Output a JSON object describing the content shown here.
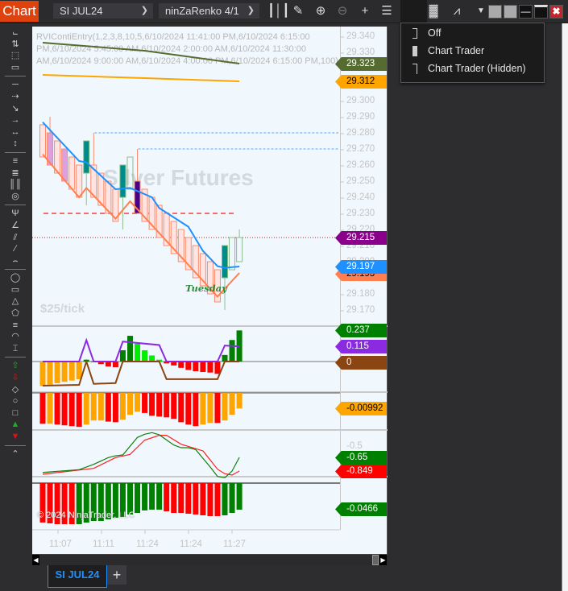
{
  "toolbar": {
    "chart_label": "Chart",
    "instrument": "SI JUL24",
    "interval": "ninZaRenko 4/1",
    "icons": [
      "bar-type-icon",
      "pencil-icon",
      "zoom-in-icon",
      "zoom-out-icon",
      "crosshair-icon",
      "properties-icon",
      "chart-trader-icon",
      "data-box-icon",
      "indicators-icon",
      "dropdown-arrow-icon"
    ]
  },
  "chart_trader_menu": {
    "items": [
      {
        "label": "Off"
      },
      {
        "label": "Chart Trader"
      },
      {
        "label": "Chart Trader (Hidden)"
      }
    ]
  },
  "left_tools": [
    "ruler",
    "risk-reward",
    "region-v",
    "region-h",
    "|",
    "line",
    "ray",
    "arrow-line",
    "extended-line",
    "horizontal-line",
    "vertical-line",
    "|",
    "andrews-pitchfork",
    "fib-retracement",
    "fib-time",
    "fib-circle",
    "|",
    "gann-fan",
    "regression",
    "trend-channel",
    "parallel",
    "arc",
    "|",
    "ellipse",
    "rectangle",
    "triangle",
    "polygon",
    "time-cycles",
    "arc2",
    "text",
    "|",
    "arrow-up",
    "arrow-down",
    "diamond",
    "dot",
    "square",
    "triangle-up",
    "triangle-down",
    "|",
    "more"
  ],
  "indicator_text": "RVIContiEntry(1,2,3,8,10,5,6/10/2024 11:41:00 PM,6/10/2024 6:15:00 PM,6/10/2024 5:45:00 AM,6/10/2024 2:00:00 AM,6/10/2024 11:30:00 AM,6/10/2024 9:00:00 AM,6/10/2024 4:00:00 PM,6/10/2024 6:15:00 PM,100)",
  "watermark": "Silver Futures",
  "tick_value": "$25/tick",
  "day_label": "Tuesday",
  "copyright": "© 2024 NinjaTrader, LLC",
  "price_axis": [
    "29.340",
    "29.330",
    "29.320",
    "29.310",
    "29.300",
    "29.290",
    "29.280",
    "29.270",
    "29.260",
    "29.250",
    "29.240",
    "29.230",
    "29.220",
    "29.210",
    "29.200",
    "29.190",
    "29.180",
    "29.170"
  ],
  "price_tags": [
    {
      "value": "29.323",
      "bg": "#556b2f",
      "fg": "#ffffff",
      "price": 29.323
    },
    {
      "value": "29.312",
      "bg": "#ffa500",
      "fg": "#000000",
      "price": 29.312
    },
    {
      "value": "29.215",
      "bg": "#8b008b",
      "fg": "#ffffff",
      "price": 29.215
    },
    {
      "value": "29.193",
      "bg": "#ff7f50",
      "fg": "#000000",
      "price": 29.193
    },
    {
      "value": "29.197",
      "bg": "#1e90ff",
      "fg": "#ffffff",
      "price": 29.197
    }
  ],
  "pane_tags": [
    {
      "value": "0.237",
      "bg": "#008000",
      "fg": "#ffffff"
    },
    {
      "value": "0.115",
      "bg": "#8a2be2",
      "fg": "#ffffff"
    },
    {
      "value": "0",
      "bg": "#8b4513",
      "fg": "#ffffff"
    },
    {
      "value": "-0.00992",
      "bg": "#ffa500",
      "fg": "#000000"
    },
    {
      "value": "-0.65",
      "bg": "#008000",
      "fg": "#ffffff"
    },
    {
      "value": "-0.849",
      "bg": "#ff0000",
      "fg": "#ffffff"
    },
    {
      "value": "-0.0466",
      "bg": "#008000",
      "fg": "#ffffff"
    }
  ],
  "pane4_axis": "-0.5",
  "time_axis": [
    "11:07",
    "11:11",
    "11:24",
    "11:24",
    "11:27"
  ],
  "tabs": [
    {
      "label": "SI JUL24"
    }
  ],
  "add_tab": "+",
  "chart_data": {
    "type": "renko",
    "bars": [
      {
        "o": 29.285,
        "c": 29.265,
        "s": "bear"
      },
      {
        "o": 29.28,
        "c": 29.26,
        "h": 29.29,
        "s": "lav"
      },
      {
        "o": 29.275,
        "c": 29.255,
        "s": "bear"
      },
      {
        "o": 29.27,
        "c": 29.25,
        "s": "lav"
      },
      {
        "o": 29.265,
        "c": 29.245,
        "s": "bear"
      },
      {
        "o": 29.26,
        "c": 29.24,
        "s": "bear"
      },
      {
        "o": 29.255,
        "c": 29.275,
        "l": 29.235,
        "s": "teal"
      },
      {
        "o": 29.26,
        "c": 29.24,
        "h": 29.28,
        "s": "bear"
      },
      {
        "o": 29.255,
        "c": 29.235,
        "s": "bear"
      },
      {
        "o": 29.25,
        "c": 29.23,
        "s": "bear"
      },
      {
        "o": 29.245,
        "c": 29.225,
        "s": "bear"
      },
      {
        "o": 29.24,
        "c": 29.26,
        "l": 29.22,
        "s": "teal"
      },
      {
        "o": 29.245,
        "c": 29.265,
        "s": "hollow"
      },
      {
        "o": 29.25,
        "c": 29.23,
        "h": 29.27,
        "s": "indigo"
      },
      {
        "o": 29.245,
        "c": 29.225,
        "s": "bear"
      },
      {
        "o": 29.24,
        "c": 29.22,
        "s": "bear"
      },
      {
        "o": 29.235,
        "c": 29.215,
        "s": "bear"
      },
      {
        "o": 29.23,
        "c": 29.21,
        "s": "bear"
      },
      {
        "o": 29.225,
        "c": 29.205,
        "s": "bear"
      },
      {
        "o": 29.22,
        "c": 29.2,
        "s": "bear"
      },
      {
        "o": 29.215,
        "c": 29.195,
        "s": "bear"
      },
      {
        "o": 29.21,
        "c": 29.19,
        "s": "bear"
      },
      {
        "o": 29.205,
        "c": 29.185,
        "s": "bear"
      },
      {
        "o": 29.2,
        "c": 29.18,
        "s": "bear"
      },
      {
        "o": 29.195,
        "c": 29.175,
        "s": "bear"
      },
      {
        "o": 29.19,
        "c": 29.21,
        "l": 29.17,
        "s": "teal"
      },
      {
        "o": 29.195,
        "c": 29.215,
        "s": "hollow"
      },
      {
        "o": 29.2,
        "c": 29.215,
        "h": 29.22,
        "s": "hollow"
      }
    ],
    "blue_line": [
      [
        0,
        29.2866
      ],
      [
        5,
        29.2625
      ],
      [
        6,
        29.2617
      ],
      [
        10,
        29.245
      ],
      [
        12,
        29.2458
      ],
      [
        15,
        29.24
      ],
      [
        16,
        29.2333
      ],
      [
        20,
        29.2217
      ],
      [
        22,
        29.2067
      ],
      [
        24,
        29.1972
      ],
      [
        25,
        29.1962
      ],
      [
        27,
        29.197
      ]
    ],
    "orange_line": [
      [
        0,
        29.2667
      ],
      [
        5,
        29.24
      ],
      [
        6,
        29.2458
      ],
      [
        10,
        29.2267
      ],
      [
        12,
        29.2375
      ],
      [
        24,
        29.1783
      ],
      [
        27,
        29.193
      ]
    ],
    "olive_line": [
      [
        0,
        29.336
      ],
      [
        14,
        29.331
      ],
      [
        27,
        29.323
      ]
    ],
    "gold_line": [
      [
        0,
        29.316
      ],
      [
        14,
        29.314
      ],
      [
        27,
        29.312
      ]
    ],
    "levels": [
      {
        "price": 29.23,
        "style": "red-dash",
        "from": 0,
        "to": 26
      },
      {
        "price": 29.28,
        "style": "blue-dash",
        "from": 7
      },
      {
        "price": 29.27,
        "style": "blue-dash",
        "from": 13
      },
      {
        "price": 29.215,
        "style": "red-dot",
        "from": -1
      }
    ],
    "pane2": {
      "hist": [
        -0.187,
        -0.177,
        -0.165,
        -0.155,
        -0.145,
        -0.135,
        0.014,
        -0.005,
        -0.02,
        -0.038,
        -0.044,
        0.086,
        0.196,
        0.136,
        0.086,
        0.046,
        0.014,
        -0.014,
        -0.03,
        -0.048,
        -0.064,
        -0.074,
        -0.08,
        -0.084,
        -0.094,
        0.05,
        0.164,
        0.237
      ],
      "colors": [
        "o",
        "o",
        "o",
        "o",
        "o",
        "o",
        "g",
        "r",
        "r",
        "r",
        "r",
        "g",
        "g",
        "l",
        "l",
        "l",
        "l",
        "r",
        "r",
        "r",
        "r",
        "r",
        "r",
        "r",
        "r",
        "g",
        "g",
        "g"
      ],
      "purple": [
        [
          0,
          0
        ],
        [
          5,
          0
        ],
        [
          6,
          0.163
        ],
        [
          7,
          0
        ],
        [
          10,
          0
        ],
        [
          11,
          0.152
        ],
        [
          16,
          0.126
        ],
        [
          17,
          0
        ],
        [
          24,
          0
        ],
        [
          25,
          0.122
        ],
        [
          27,
          0.115
        ]
      ],
      "brown": [
        [
          0,
          -0.184
        ],
        [
          5,
          -0.178
        ],
        [
          6,
          0
        ],
        [
          7,
          -0.17
        ],
        [
          10,
          -0.164
        ],
        [
          11,
          0
        ],
        [
          16,
          0
        ],
        [
          17,
          -0.134
        ],
        [
          24,
          -0.134
        ],
        [
          25,
          0
        ],
        [
          27,
          0
        ]
      ]
    },
    "pane3": {
      "hist": [
        -0.0197,
        -0.0197,
        -0.0202,
        -0.0207,
        -0.0212,
        -0.0217,
        -0.0202,
        -0.0176,
        -0.0176,
        -0.0183,
        -0.0187,
        -0.0171,
        -0.014,
        -0.012,
        -0.0128,
        -0.0146,
        -0.0151,
        -0.0156,
        -0.0166,
        -0.0187,
        -0.0202,
        -0.0212,
        -0.0202,
        -0.0192,
        -0.0192,
        -0.0176,
        -0.014,
        -0.00992
      ],
      "colors": [
        "r",
        "o",
        "r",
        "r",
        "r",
        "r",
        "o",
        "o",
        "o",
        "r",
        "r",
        "o",
        "o",
        "o",
        "r",
        "r",
        "r",
        "r",
        "r",
        "r",
        "r",
        "r",
        "o",
        "o",
        "r",
        "o",
        "o",
        "o"
      ]
    },
    "pane4": {
      "green": [
        [
          0,
          -0.869
        ],
        [
          5,
          -0.829
        ],
        [
          7,
          -0.752
        ],
        [
          9,
          -0.654
        ],
        [
          10,
          -0.627
        ],
        [
          11,
          -0.615
        ],
        [
          13,
          -0.361
        ],
        [
          14,
          -0.314
        ],
        [
          15,
          -0.291
        ],
        [
          16,
          -0.322
        ],
        [
          18,
          -0.471
        ],
        [
          19,
          -0.51
        ],
        [
          20,
          -0.51
        ],
        [
          21,
          -0.537
        ],
        [
          23,
          -0.79
        ],
        [
          24,
          -0.927
        ],
        [
          25,
          -0.946
        ],
        [
          26,
          -0.849
        ],
        [
          27,
          -0.65
        ]
      ],
      "red": [
        [
          0,
          -0.896
        ],
        [
          7,
          -0.81
        ],
        [
          10,
          -0.654
        ],
        [
          12,
          -0.607
        ],
        [
          14,
          -0.4
        ],
        [
          16,
          -0.33
        ],
        [
          17,
          -0.33
        ],
        [
          19,
          -0.459
        ],
        [
          22,
          -0.556
        ],
        [
          24,
          -0.822
        ],
        [
          25,
          -0.888
        ],
        [
          26,
          -0.907
        ],
        [
          27,
          -0.849
        ]
      ]
    },
    "pane5": {
      "hist": [
        -0.069,
        -0.0705,
        -0.0719,
        -0.0719,
        -0.0719,
        -0.0719,
        -0.0691,
        -0.0663,
        -0.0663,
        -0.0635,
        -0.0606,
        -0.0592,
        -0.055,
        -0.0522,
        -0.0479,
        -0.0465,
        -0.0465,
        -0.0494,
        -0.0522,
        -0.0522,
        -0.0536,
        -0.055,
        -0.0564,
        -0.0578,
        -0.0578,
        -0.0564,
        -0.0522,
        -0.0466
      ],
      "colors": [
        "r",
        "r",
        "r",
        "r",
        "r",
        "g",
        "g",
        "g",
        "g",
        "g",
        "g",
        "g",
        "g",
        "g",
        "g",
        "g",
        "g",
        "r",
        "r",
        "r",
        "r",
        "r",
        "r",
        "r",
        "r",
        "g",
        "g",
        "g"
      ]
    }
  }
}
